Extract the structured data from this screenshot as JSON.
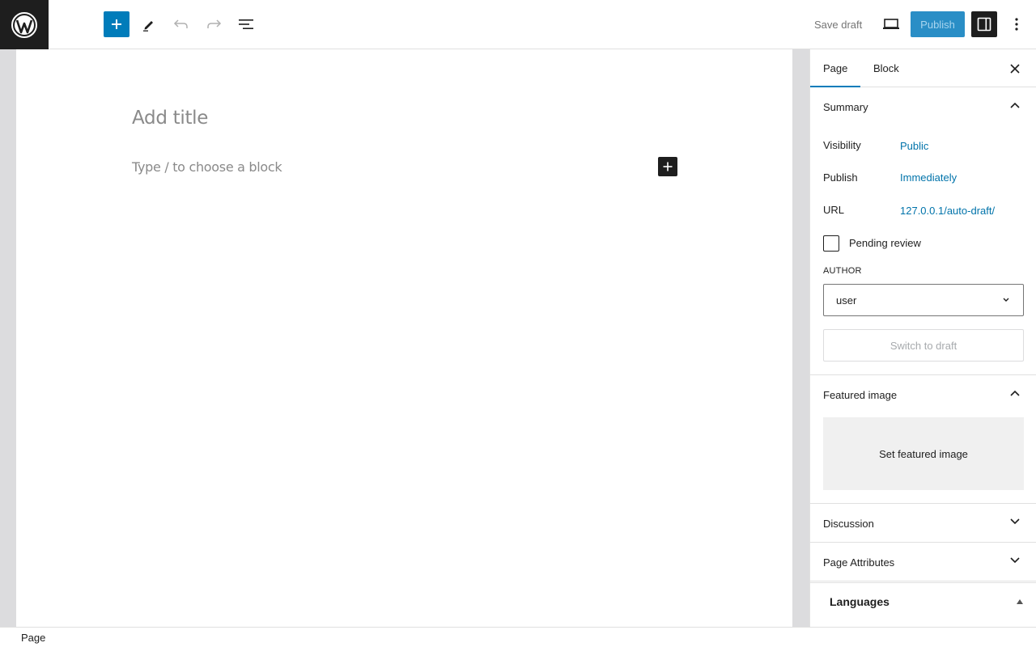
{
  "header": {
    "save_draft": "Save draft",
    "publish": "Publish",
    "icons": [
      "wordpress-logo",
      "plus-icon",
      "pencil-icon",
      "undo-icon",
      "redo-icon",
      "list-view-icon",
      "desktop-icon",
      "sidebar-icon",
      "more-vertical-icon"
    ]
  },
  "editor": {
    "title_placeholder": "Add title",
    "block_placeholder": "Type / to choose a block"
  },
  "sidebar": {
    "tabs": [
      "Page",
      "Block"
    ],
    "active_tab": "Page",
    "summary": {
      "title": "Summary",
      "visibility_label": "Visibility",
      "visibility_value": "Public",
      "publish_label": "Publish",
      "publish_value": "Immediately",
      "url_label": "URL",
      "url_value": "127.0.0.1/auto-draft/",
      "pending_review": "Pending review",
      "author_label": "AUTHOR",
      "author_value": "user",
      "switch_to_draft": "Switch to draft"
    },
    "featured_image": {
      "title": "Featured image",
      "set_label": "Set featured image"
    },
    "discussion": "Discussion",
    "page_attributes": "Page Attributes",
    "languages": "Languages"
  },
  "footer": {
    "breadcrumb": "Page"
  },
  "colors": {
    "accent": "#007cba",
    "link": "#0073aa",
    "dark": "#1e1e1e",
    "canvas_bg": "#dcdcde"
  }
}
